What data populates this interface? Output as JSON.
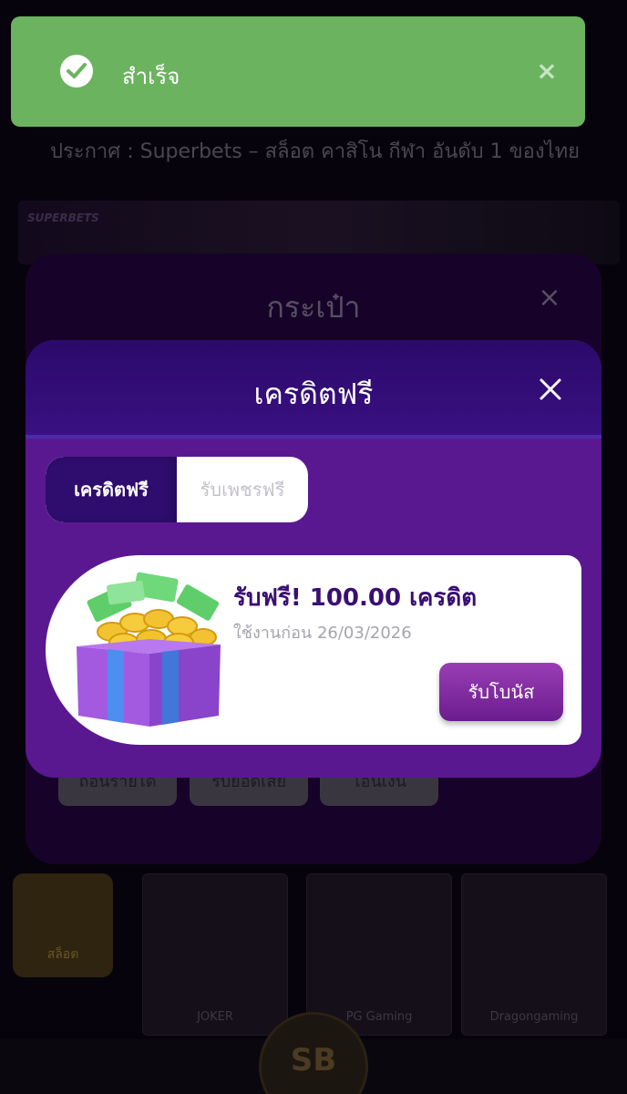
{
  "toast": {
    "message": "สำเร็จ",
    "close_symbol": "×"
  },
  "background": {
    "announcement": "ประกาศ : Superbets – สล็อต คาสิโน กีฬา อันดับ 1 ของไทย",
    "banner_logo": "SUPERBETS",
    "wallet_title": "กระเป๋า",
    "wallet_close_symbol": "×",
    "wallet_buttons": [
      "ถอนรายได้",
      "รับยอดเสีย",
      "โอนเงิน"
    ],
    "category_label": "สล็อต",
    "game_cards": [
      "JOKER",
      "PG Gaming",
      "Dragongaming"
    ],
    "nav_logo": "SB"
  },
  "modal": {
    "title": "เครดิตฟรี",
    "tabs": [
      {
        "label": "เครดิตฟรี",
        "active": true
      },
      {
        "label": "รับเพชรฟรี",
        "active": false
      }
    ],
    "promo": {
      "title": "รับฟรี! 100.00 เครดิต",
      "subtitle": "ใช้งานก่อน 26/03/2026",
      "button_label": "รับโบนัส",
      "image_icon": "gift-box-with-coins-icon"
    }
  },
  "colors": {
    "toast_bg": "#6bb35f",
    "modal_bg": "#5a1890",
    "modal_header": "#2a0a6a",
    "accent_purple": "#7a2aa0"
  }
}
